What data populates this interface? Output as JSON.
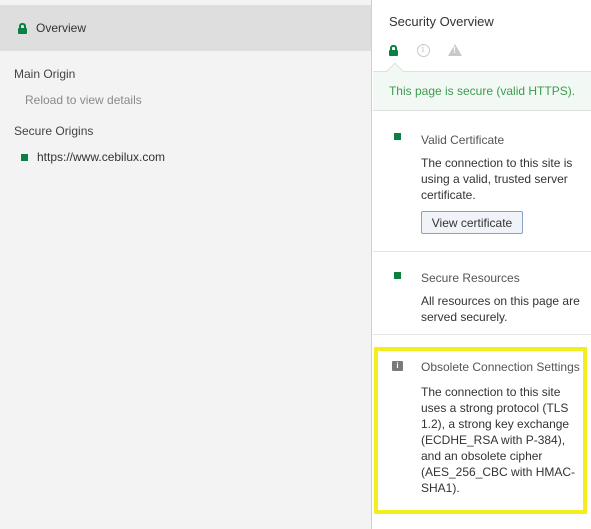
{
  "sidebar": {
    "overview_label": "Overview",
    "main_origin_title": "Main Origin",
    "main_origin_hint": "Reload to view details",
    "secure_origins_title": "Secure Origins",
    "secure_origins": [
      "https://www.cebilux.com"
    ]
  },
  "panel": {
    "title": "Security Overview",
    "tabs": [
      {
        "icon": "lock-icon",
        "state": "active"
      },
      {
        "icon": "info-icon",
        "state": "inactive"
      },
      {
        "icon": "warning-icon",
        "state": "inactive"
      }
    ],
    "summary": "This page is secure (valid HTTPS).",
    "cards": {
      "certificate": {
        "title": "Valid Certificate",
        "description": "The connection to this site is using a valid, trusted server certificate.",
        "button_label": "View certificate"
      },
      "resources": {
        "title": "Secure Resources",
        "description": "All resources on this page are served securely."
      },
      "connection": {
        "title": "Obsolete Connection Settings",
        "description": "The connection to this site uses a strong protocol (TLS 1.2), a strong key exchange (ECDHE_RSA with P-384), and an obsolete cipher (AES_256_CBC with HMAC-SHA1)."
      }
    }
  },
  "colors": {
    "secure_green": "#0b8043",
    "summary_text": "#3c9c4e",
    "highlight": "#f5ee1e",
    "info_marker": "#7a7a7a"
  }
}
